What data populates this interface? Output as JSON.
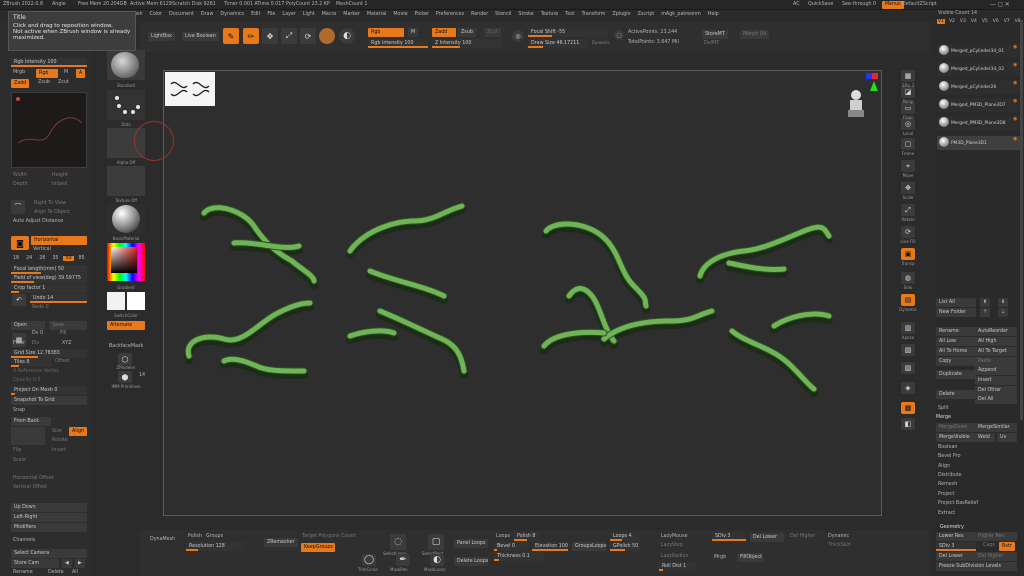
{
  "menubar": {
    "app_info": "ZBrush 2022.0.8",
    "stats": [
      "Angle",
      "Free Mem 20.204GB",
      "Active Mem 6129",
      "Scratch Disk 9261",
      "Timer 0.001 ATime 0.017",
      "PolyCount 23.2 KP",
      "MeshCount 1"
    ],
    "menus": [
      "Alpha",
      "Brush",
      "Color",
      "Document",
      "Draw",
      "Dynamics",
      "Edit",
      "File",
      "Layer",
      "Light",
      "Macro",
      "Marker",
      "Material",
      "Movie",
      "Picker",
      "Preferences",
      "Render",
      "Stencil",
      "Stroke",
      "Texture",
      "Tool",
      "Transform",
      "Zplugin",
      "Zscript",
      "mAgk_patreonm",
      "Help"
    ],
    "right": {
      "ac": "AC",
      "quicksave": "QuickSave",
      "seethrough": "See-through 0",
      "menus": "Menus",
      "script": "DefaultZScript"
    }
  },
  "tooltip": {
    "title": "Title",
    "line1": "Click and drag to reposition window.",
    "line2": "Not active when ZBrush window is already",
    "line3": "maximized."
  },
  "top_toolbar": {
    "lightbox": "LightBox",
    "live_boolean": "Live Boolean",
    "edit": "Edit",
    "draw": "Draw",
    "move": "Move",
    "scale": "Scale",
    "rotate": "Rotate",
    "rgb": "Rgb",
    "m": "M",
    "zadd": "Zadd",
    "zsub": "Zsub",
    "zcut": "Zcut",
    "rgb_intensity": "Rgb Intensity 100",
    "z_intensity": "Z Intensity 100",
    "focal_shift": "Focal Shift -55",
    "draw_size": "Draw Size 46.17211",
    "dynamic": "Dynamic",
    "active_points": "ActivePoints: 23,244",
    "total_points": "TotalPoints: 3.647 Mil",
    "storemt": "StoreMT",
    "delmt": "DelMT",
    "morph_uv": "Morph UV"
  },
  "left_panel": {
    "intensity": "Intensity",
    "rgb_intensity": "Rgb Intensity 100",
    "mrgb": "Mrgb",
    "rgb": "Rgb",
    "m": "M",
    "a": "A",
    "zadd": "Zadd",
    "zsub": "Zsub",
    "zcut": "Zcut",
    "width": "Width",
    "height": "Height",
    "depth": "Depth",
    "imbed": "Imbed",
    "right_to_view": "Right To View",
    "align_to_object": "Align To Object",
    "auto_adjust": "Auto Adjust Distance",
    "horizontal": "Horizontal",
    "vertical": "Vertical",
    "focal_numbers": [
      "18",
      "24",
      "28",
      "35",
      "50",
      "85"
    ],
    "focal_length": "Focal length(mm) 50",
    "fov": "Field of view(deg) 39.59775",
    "crop_factor": "Crop factor 1",
    "undo": "Undo 14",
    "redo": "Redo 0",
    "open": "Open",
    "save": "Save",
    "dv": "Dv 0",
    "fill": "Fill",
    "floor": "Floor",
    "elv": "Elv",
    "xyz": "XYZ",
    "grid_size": "Grid Size 12.78383",
    "tiles": "Tiles 8",
    "offset": "Offset",
    "x_reference": "X Reference Vertex",
    "opacity": "Opacity 0.5",
    "project_on_mesh": "Project On Mesh 0",
    "snapshot": "Snapshot To Grid",
    "snap": "Snap",
    "from_back": "From Back",
    "map1": "Map1",
    "size": "Size",
    "align": "Align",
    "rotate": "Rotate",
    "flip": "Flip",
    "invert": "Invert",
    "scale": "Scale",
    "horiz_offset": "Horizontal Offset",
    "vert_offset": "Vertical Offset",
    "up_down": "Up Down",
    "left_right": "Left-Right",
    "modifiers": "Modifiers",
    "channels": "Channels",
    "select_camera": "Select Camera",
    "store_cam": "Store Cam",
    "rename": "Rename",
    "delete": "Delete",
    "all": "All"
  },
  "palette": {
    "standard": "Standard",
    "dots": "Dots",
    "alpha_off": "Alpha Off",
    "texture_off": "Texture Off",
    "basic_material": "BasicMaterial",
    "gradient": "Gradient",
    "switch_color": "SwitchColor",
    "alternate": "Alternate",
    "backface_mask": "BackfaceMask",
    "zmodeler": "ZModeler",
    "imm_primitives": "IMM Primitives",
    "count": "14"
  },
  "right_tools": [
    "SPix 3",
    "Persp",
    "Floor",
    "Local",
    "Frame",
    "Move",
    "Scale",
    "Rotate",
    "Line Fill",
    "Transp",
    "Solo",
    "Dynamic",
    "Xpose"
  ],
  "subtool": {
    "visible_count": "Visible Count 14",
    "versions": [
      "V1",
      "V2",
      "V3",
      "V4",
      "V5",
      "V6",
      "V7",
      "V8"
    ],
    "items": [
      "Merged_pCylinder34_01",
      "Merged_pCylinder34_02",
      "Merged_pCylinder26",
      "Merged_PM3D_Plane3D7",
      "Merged_PM3D_Plane3D8",
      "PM3D_Plane3D1"
    ],
    "list_all": "List All",
    "new_folder": "New Folder",
    "rename": "Rename",
    "autoreorder": "AutoReorder",
    "all_low": "All Low",
    "all_high": "All High",
    "all_to_home": "All To Home",
    "all_to_target": "All To Target",
    "copy": "Copy",
    "paste": "Paste",
    "duplicate": "Duplicate",
    "append": "Append",
    "insert": "Insert",
    "delete": "Delete",
    "del_other": "Del Other",
    "del_all": "Del All",
    "split": "Split",
    "merge": "Merge",
    "merge_down": "MergeDown",
    "merge_similar": "MergeSimilar",
    "merge_visible": "MergeVisible",
    "weld": "Weld",
    "uv": "Uv",
    "boolean": "Boolean",
    "bevel_pro": "Bevel Pro",
    "align": "Align",
    "distribute": "Distribute",
    "remesh": "Remesh",
    "project": "Project",
    "project_basrelief": "Project BasRelief",
    "extract": "Extract",
    "geometry": "Geometry",
    "lower_res": "Lower Res",
    "higher_res": "Higher Res",
    "sdiv": "SDiv 3",
    "cage": "Cage",
    "rstr": "Rstr",
    "del_lower": "Del Lower",
    "del_higher": "Del Higher",
    "freeze": "Freeze SubDivision Levels"
  },
  "bottom": {
    "dynamesh": "DynaMesh",
    "polish": "Polish",
    "groups": "Groups",
    "resolution": "Resolution 128",
    "zremesher": "ZRemesher",
    "target_polygons": "Target Polygons Count",
    "keepgroups": "KeepGroups",
    "select_lasso": "SelectLasso",
    "select_rect": "SelectRect",
    "trimcircle": "TrimCircle",
    "maskpen": "MaskPen",
    "mask_lasso": "MaskLasso",
    "panel_loops": "Panel Loops",
    "delete_loops": "Delete Loops",
    "loops": "Loops",
    "polish_val": "Polish 8",
    "bevel": "Bevel 0",
    "elevation": "Elevation 100",
    "thickness": "Thickness 0.1",
    "groups_loops": "GroupsLoops",
    "loops4": "Loops 4",
    "gpolish": "GPolish 50",
    "lazymouse": "LazyMouse",
    "lazystep": "LazyStep",
    "lazyradius": "LazyRadius",
    "roll_dist": "Roll Dist 1",
    "sdiv": "SDiv 3",
    "del_lower": "Del Lower",
    "del_higher": "Del Higher",
    "mrgb": "Mrgb",
    "fillobject": "FillObject",
    "dynamic": "Dynamic",
    "thickskin": "ThickSkin"
  },
  "colors": {
    "accent": "#e8791b",
    "mesh_green": "#6fb456",
    "mesh_dark": "#2f4d26",
    "canvas": "#2e2e2e"
  }
}
